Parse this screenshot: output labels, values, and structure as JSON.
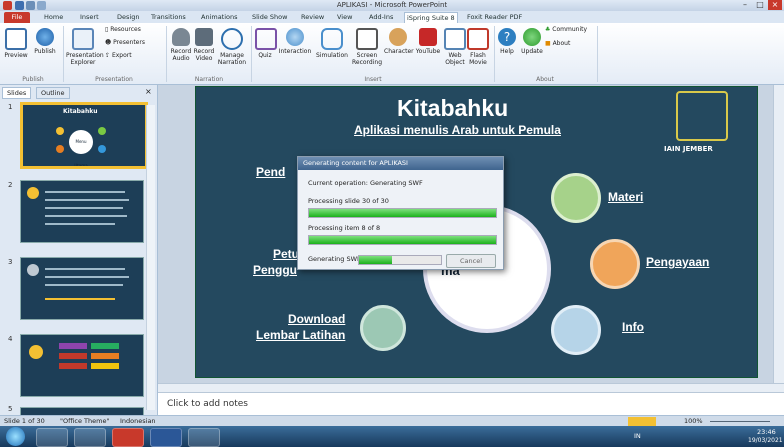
{
  "window": {
    "title": "APLIKASI - Microsoft PowerPoint"
  },
  "tabs": [
    "File",
    "Home",
    "Insert",
    "Design",
    "Transitions",
    "Animations",
    "Slide Show",
    "Review",
    "View",
    "Add-Ins",
    "iSpring Suite 8",
    "Foxit Reader PDF"
  ],
  "ribbon": {
    "publish_group": {
      "label": "Publish",
      "buttons": [
        "Preview",
        "Publish"
      ]
    },
    "presentation_group": {
      "label": "Presentation",
      "buttons": [
        "Presentation Explorer",
        "Resources",
        "Presenters",
        "Export"
      ]
    },
    "narration_group": {
      "label": "Narration",
      "buttons": [
        "Record Audio",
        "Record Video",
        "Manage Narration"
      ]
    },
    "insert_group": {
      "label": "Insert",
      "buttons": [
        "Quiz",
        "Interaction",
        "Simulation",
        "Screen Recording",
        "Character",
        "YouTube",
        "Web Object",
        "Flash Movie"
      ]
    },
    "about_group": {
      "label": "About",
      "buttons": [
        "Help",
        "Update",
        "Community",
        "About"
      ]
    }
  },
  "left_pane": {
    "tabs": [
      "Slides",
      "Outline"
    ],
    "thumbnails": [
      {
        "num": "1",
        "title": "Kitabahku",
        "center": "Menu Utama"
      },
      {
        "num": "2"
      },
      {
        "num": "3"
      },
      {
        "num": "4"
      },
      {
        "num": "5"
      }
    ]
  },
  "slide": {
    "title": "Kitabahku",
    "subtitle": "Aplikasi menulis Arab untuk Pemula",
    "logo_text": "IAIN JEMBER",
    "links": {
      "left1": "Pend",
      "left2_line1": "Petu",
      "left2_line2": "Penggu",
      "download_line1": "Download",
      "download_line2": "Lembar Latihan",
      "materi": "Materi",
      "pengayaan": "Pengayaan",
      "info": "Info",
      "center_text": "ma"
    }
  },
  "dialog": {
    "title": "Generating content for APLIKASI",
    "current_operation": "Current operation:   Generating SWF",
    "slide_progress_label": "Processing slide 30 of 30",
    "slide_progress": 1.0,
    "item_progress_label": "Processing item 8 of 8",
    "item_progress": 1.0,
    "swf_label": "Generating SWF",
    "swf_progress": 0.4,
    "cancel": "Cancel"
  },
  "notes": {
    "placeholder": "Click to add notes"
  },
  "status": {
    "slide": "Slide 1 of 30",
    "theme": "\"Office Theme\"",
    "language": "Indonesian",
    "zoom": "100%"
  },
  "taskbar": {
    "lang": "IN",
    "time": "23:46",
    "date": "19/03/2021"
  },
  "colors": {
    "slide_bg": "#24495f",
    "file_tab": "#c8392b",
    "progress": "#1bb11b",
    "selection": "#f3c033"
  }
}
